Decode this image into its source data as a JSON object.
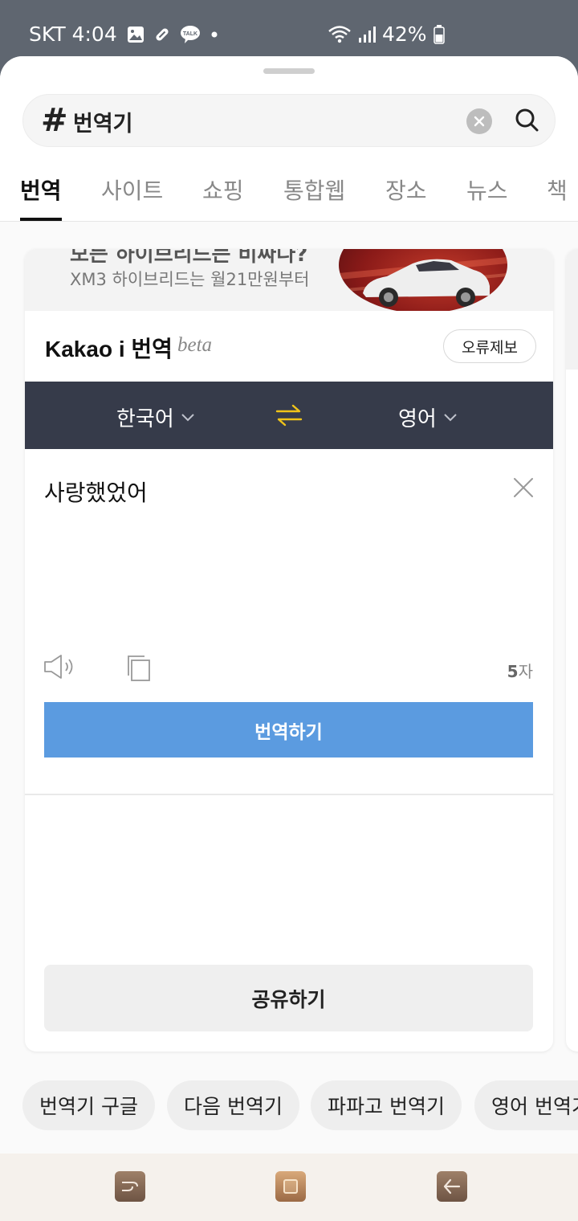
{
  "status_bar": {
    "carrier": "SKT",
    "time": "4:04",
    "battery": "42%",
    "icons": [
      "gallery-icon",
      "pill-icon",
      "kakaotalk-icon",
      "dot-icon",
      "wifi-icon",
      "signal-icon",
      "battery-icon"
    ],
    "talk_label": "TALK"
  },
  "search": {
    "prefix": "#",
    "query": "번역기"
  },
  "tabs": [
    "번역",
    "사이트",
    "쇼핑",
    "통합웹",
    "장소",
    "뉴스",
    "책"
  ],
  "active_tab": 0,
  "ad": {
    "headline": "모든 하이브리드는 비싸다?",
    "sub": "XM3 하이브리드는 월21만원부터"
  },
  "translator": {
    "title": "Kakao i 번역",
    "badge": "beta",
    "report_label": "오류제보",
    "source_lang": "한국어",
    "target_lang": "영어",
    "input_text": "사랑했었어",
    "char_count_num": "5",
    "char_count_unit": "자",
    "translate_label": "번역하기",
    "share_label": "공유하기"
  },
  "related_chips": [
    "번역기 구글",
    "다음 번역기",
    "파파고 번역기",
    "영어 번역기"
  ],
  "colors": {
    "status_bar": "#5f6670",
    "lang_bar": "#363b4a",
    "translate_button": "#5b9be0",
    "swap_icon": "#f0c419"
  }
}
